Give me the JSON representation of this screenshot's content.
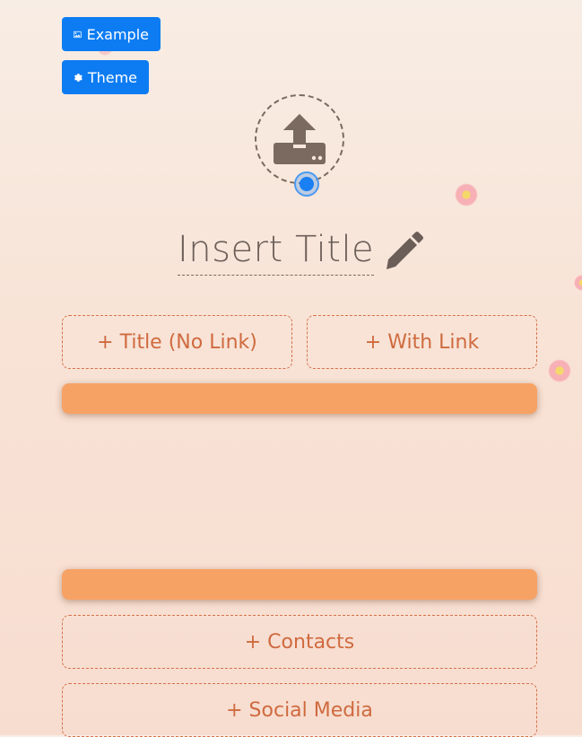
{
  "toolbar": {
    "example_label": "Example",
    "theme_label": "Theme"
  },
  "profile": {
    "title": "Insert Title"
  },
  "buttons": {
    "title_no_link": "+ Title (No Link)",
    "with_link": "+ With Link",
    "contacts": "+ Contacts",
    "social_media": "+ Social Media"
  },
  "colors": {
    "primary_button": "#0d7cf2",
    "accent": "#d4734a",
    "bar": "#f7a265"
  },
  "icons": {
    "example": "image-icon",
    "theme": "gear-icon",
    "upload": "upload-icon",
    "edit": "pencil-icon"
  }
}
